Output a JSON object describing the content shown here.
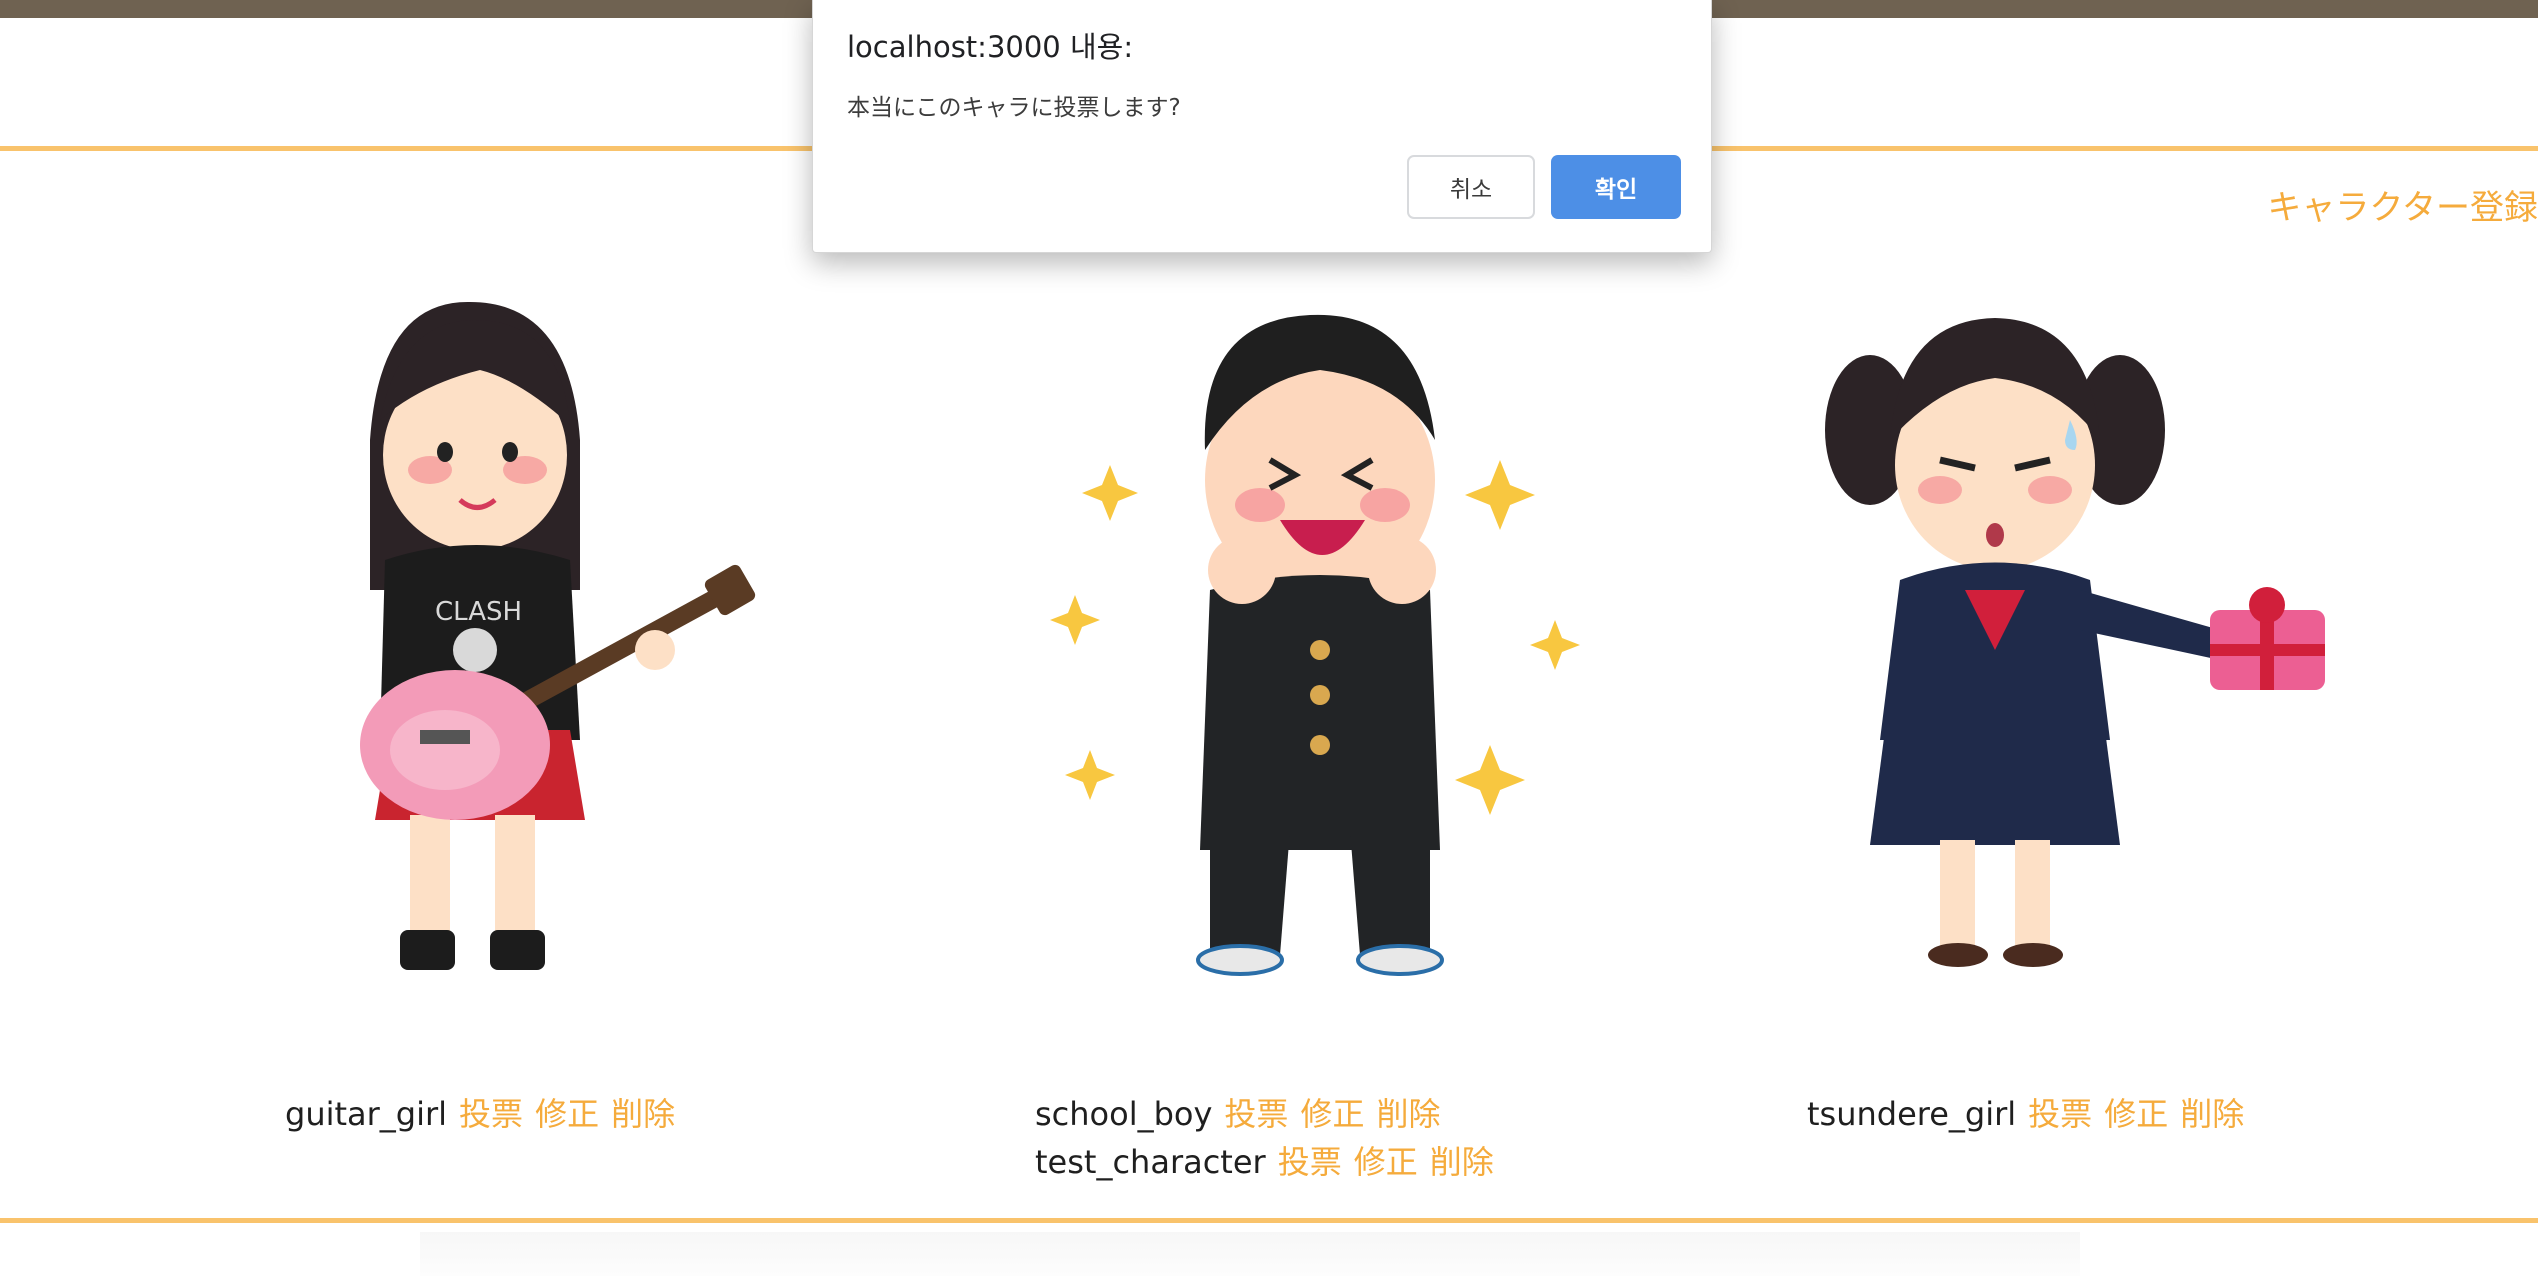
{
  "dialog": {
    "title": "localhost:3000 내용:",
    "message": "本当にこのキャラに投票します?",
    "cancel_label": "취소",
    "ok_label": "확인"
  },
  "header": {
    "register_label": "キャラクター登録"
  },
  "actions": {
    "vote": "投票",
    "edit": "修正",
    "delete": "削除"
  },
  "characters": [
    {
      "name": "guitar_girl"
    },
    {
      "name": "school_boy"
    },
    {
      "name": "test_character"
    },
    {
      "name": "tsundere_girl"
    }
  ],
  "colors": {
    "accent": "#f5ab3c",
    "rule": "#f9c36c",
    "topbar": "#6f6251",
    "ok_button": "#4d8fe6"
  }
}
